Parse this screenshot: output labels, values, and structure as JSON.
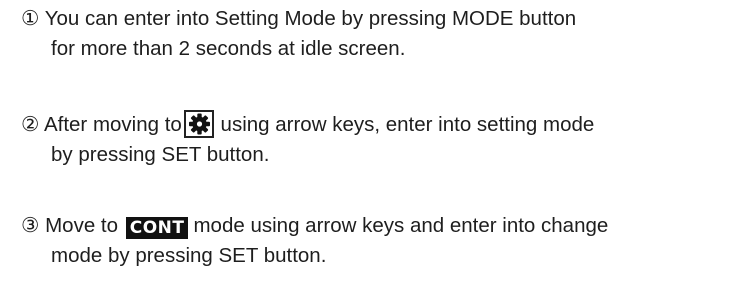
{
  "steps": [
    {
      "marker": "①",
      "line1": "You can enter into Setting Mode by pressing MODE button",
      "line2": "for more than 2 seconds at idle screen."
    },
    {
      "marker": "②",
      "line1_before": "After moving to",
      "icon": "gear-icon",
      "line1_after": "using arrow keys, enter into setting mode",
      "line2": "by pressing SET button."
    },
    {
      "marker": "③",
      "line1_before": "Move to",
      "badge": "CONT",
      "line1_after": "mode using arrow keys and enter into change",
      "line2": "mode by pressing SET button."
    }
  ]
}
